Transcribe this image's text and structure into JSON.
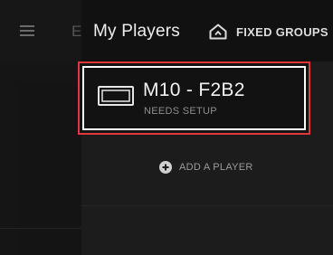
{
  "background_app": {
    "partial_title_letter": "E"
  },
  "drawer": {
    "title": "My Players",
    "fixed_groups_label": "FIXED GROUPS",
    "players": [
      {
        "name": "M10 - F2B2",
        "status": "NEEDS SETUP"
      }
    ],
    "add_player_label": "ADD A PLAYER"
  },
  "colors": {
    "highlight_border": "#e0383a",
    "drawer_header_bg": "#111111",
    "drawer_bg": "#1c1c1c"
  },
  "icons": {
    "menu": "hamburger-menu-icon",
    "fixed_groups": "home-group-icon",
    "player": "player-device-icon",
    "add": "plus-circle-icon"
  }
}
